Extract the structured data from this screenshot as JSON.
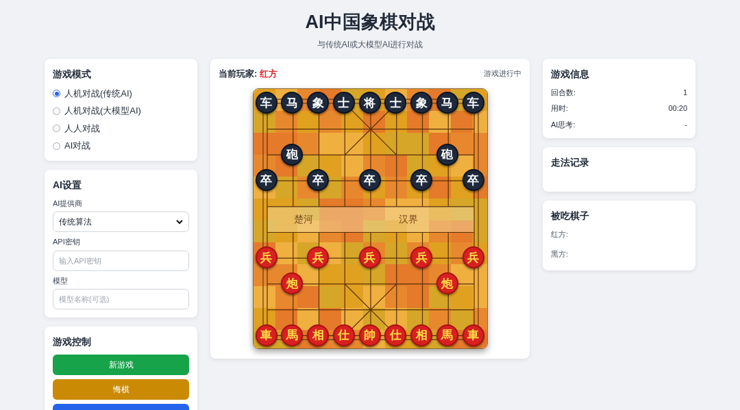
{
  "header": {
    "title": "AI中国象棋对战",
    "subtitle": "与传统AI或大模型AI进行对战"
  },
  "mode_card": {
    "title": "游戏模式",
    "options": [
      {
        "label": "人机对战(传统AI)",
        "selected": true
      },
      {
        "label": "人机对战(大模型AI)",
        "selected": false
      },
      {
        "label": "人人对战",
        "selected": false
      },
      {
        "label": "AI对战",
        "selected": false
      }
    ]
  },
  "ai_card": {
    "title": "AI设置",
    "fields": [
      {
        "kind": "select",
        "label": "AI提供商",
        "value": "传统算法"
      },
      {
        "kind": "input",
        "label": "API密钥",
        "placeholder": "输入API密钥"
      },
      {
        "kind": "input",
        "label": "模型",
        "placeholder": "模型名称(可选)"
      }
    ]
  },
  "control_card": {
    "title": "游戏控制",
    "buttons": [
      {
        "label": "新游戏",
        "color": "#16a34a"
      },
      {
        "label": "悔棋",
        "color": "#ca8a04"
      },
      {
        "color": "#2563eb"
      }
    ]
  },
  "board_card": {
    "player_label": "当前玩家:",
    "player": "红方",
    "status": "游戏进行中",
    "river_left": "楚河",
    "river_right": "汉界",
    "rows": [
      [
        {
          "piece": "车",
          "color": "#1e2a3c"
        },
        {
          "piece": "马",
          "color": "#1e2a3c"
        },
        {
          "piece": "象",
          "color": "#1e2a3c"
        },
        {
          "piece": "士",
          "color": "#1e2a3c"
        },
        {
          "piece": "将",
          "color": "#1e2a3c"
        },
        {
          "piece": "士",
          "color": "#1e2a3c"
        },
        {
          "piece": "象",
          "color": "#1e2a3c"
        },
        {
          "piece": "马",
          "color": "#1e2a3c"
        },
        {
          "piece": "车",
          "color": "#1e2a3c"
        }
      ],
      [
        null,
        null,
        null,
        null,
        null,
        null,
        null,
        null,
        null
      ],
      [
        null,
        {
          "piece": "砲",
          "color": "#1e2a3c"
        },
        null,
        null,
        null,
        null,
        null,
        {
          "piece": "砲",
          "color": "#1e2a3c"
        },
        null
      ],
      [
        {
          "piece": "卒",
          "color": "#1e2a3c"
        },
        null,
        {
          "piece": "卒",
          "color": "#1e2a3c"
        },
        null,
        {
          "piece": "卒",
          "color": "#1e2a3c"
        },
        null,
        {
          "piece": "卒",
          "color": "#1e2a3c"
        },
        null,
        {
          "piece": "卒",
          "color": "#1e2a3c"
        }
      ],
      [
        null,
        null,
        null,
        null,
        null,
        null,
        null,
        null,
        null
      ],
      [
        null,
        null,
        null,
        null,
        null,
        null,
        null,
        null,
        null
      ],
      [
        {
          "piece": "兵",
          "color": "#d92020"
        },
        null,
        {
          "piece": "兵",
          "color": "#d92020"
        },
        null,
        {
          "piece": "兵",
          "color": "#d92020"
        },
        null,
        {
          "piece": "兵",
          "color": "#d92020"
        },
        null,
        {
          "piece": "兵",
          "color": "#d92020"
        }
      ],
      [
        null,
        {
          "piece": "炮",
          "color": "#d92020"
        },
        null,
        null,
        null,
        null,
        null,
        {
          "piece": "炮",
          "color": "#d92020"
        },
        null
      ],
      [
        null,
        null,
        null,
        null,
        null,
        null,
        null,
        null,
        null
      ],
      [
        {
          "piece": "車",
          "color": "#d92020"
        },
        {
          "piece": "馬",
          "color": "#d92020"
        },
        {
          "piece": "相",
          "color": "#d92020"
        },
        {
          "piece": "仕",
          "color": "#d92020"
        },
        {
          "piece": "帥",
          "color": "#d92020"
        },
        {
          "piece": "仕",
          "color": "#d92020"
        },
        {
          "piece": "相",
          "color": "#d92020"
        },
        {
          "piece": "馬",
          "color": "#d92020"
        },
        {
          "piece": "車",
          "color": "#d92020"
        }
      ]
    ]
  },
  "info_card": {
    "title": "游戏信息",
    "rows": [
      {
        "label": "回合数:",
        "value": "1"
      },
      {
        "label": "用时:",
        "value": "00:20"
      },
      {
        "label": "AI思考:",
        "value": "-"
      }
    ]
  },
  "moves_card": {
    "title": "走法记录"
  },
  "captured_card": {
    "title": "被吃棋子",
    "rows": [
      {
        "label": "红方:"
      },
      {
        "label": "黑方:"
      }
    ]
  }
}
